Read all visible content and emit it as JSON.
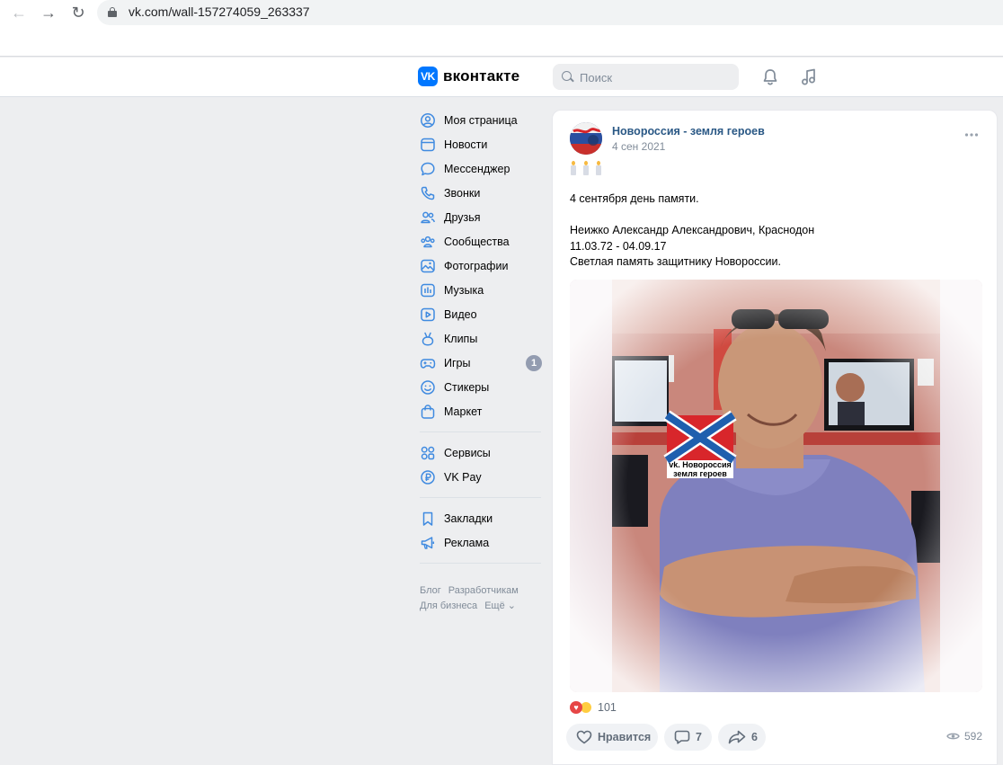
{
  "browser": {
    "url": "vk.com/wall-157274059_263337"
  },
  "header": {
    "logo_text": "VK",
    "wordmark": "вконтакте",
    "search_placeholder": "Поиск",
    "icons": [
      "bell-icon",
      "music-icon"
    ]
  },
  "menu": {
    "items": [
      {
        "label": "Моя страница",
        "icon": "user-icon"
      },
      {
        "label": "Новости",
        "icon": "news-icon"
      },
      {
        "label": "Мессенджер",
        "icon": "message-icon"
      },
      {
        "label": "Звонки",
        "icon": "phone-icon"
      },
      {
        "label": "Друзья",
        "icon": "friends-icon"
      },
      {
        "label": "Сообщества",
        "icon": "groups-icon"
      },
      {
        "label": "Фотографии",
        "icon": "photo-icon"
      },
      {
        "label": "Музыка",
        "icon": "music-icon"
      },
      {
        "label": "Видео",
        "icon": "video-icon"
      },
      {
        "label": "Клипы",
        "icon": "clips-icon"
      },
      {
        "label": "Игры",
        "icon": "gamepad-icon",
        "badge": "1"
      },
      {
        "label": "Стикеры",
        "icon": "smile-icon"
      },
      {
        "label": "Маркет",
        "icon": "bag-icon"
      }
    ],
    "items2": [
      {
        "label": "Сервисы",
        "icon": "services-icon"
      },
      {
        "label": "VK Pay",
        "icon": "vkpay-icon"
      }
    ],
    "items3": [
      {
        "label": "Закладки",
        "icon": "bookmark-icon"
      },
      {
        "label": "Реклама",
        "icon": "megaphone-icon"
      }
    ],
    "footer": {
      "blog": "Блог",
      "developers": "Разработчикам",
      "business": "Для бизнеса",
      "more": "Ещё ⌄"
    }
  },
  "post": {
    "group_name": "Новороссия - земля героев",
    "date": "4 сен 2021",
    "lines": [
      "4 сентября день памяти.",
      "",
      "Неижко Александр Александрович, Краснодон",
      "11.03.72 - 04.09.17",
      "Светлая память защитнику Новороссии."
    ],
    "watermark_line1": "vk. Новороссия",
    "watermark_line2": "земля героев",
    "reactions_count": "101",
    "like_label": "Нравится",
    "comments_count": "7",
    "shares_count": "6",
    "views_count": "592",
    "colors": {
      "link": "#2a5885",
      "accent": "#0077ff",
      "flag_red": "#d8262b",
      "flag_blue": "#1f5fae"
    }
  }
}
